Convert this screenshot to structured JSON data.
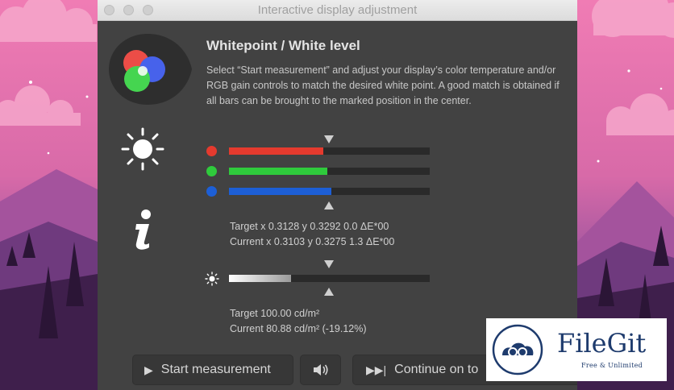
{
  "window": {
    "title": "Interactive display adjustment"
  },
  "section": {
    "heading": "Whitepoint / White level",
    "description": "Select “Start measurement” and adjust your display’s color temperature and/or RGB gain controls to match the desired white point. A good match is obtained if all bars can be brought to the marked position in the center."
  },
  "rgb_bars": [
    {
      "channel": "red",
      "color": "#e53a2e",
      "fill": 0.47
    },
    {
      "channel": "green",
      "color": "#2fcb3c",
      "fill": 0.49
    },
    {
      "channel": "blue",
      "color": "#1d5fd6",
      "fill": 0.51
    }
  ],
  "whitepoint": {
    "target": "Target x 0.3128 y 0.3292 0.0 ΔE*00",
    "current": "Current x 0.3103 y 0.3275 1.3 ΔE*00"
  },
  "luminance": {
    "fill": 0.31,
    "target": "Target 100.00 cd/m²",
    "current": "Current 80.88 cd/m² (-19.12%)"
  },
  "buttons": {
    "start": "Start measurement",
    "continue": "Continue on to"
  },
  "icons": {
    "rgb": "rgb-circles-icon",
    "brightness": "sun-icon",
    "info": "info-icon",
    "play": "play-icon",
    "sound": "speaker-icon",
    "skip": "skip-forward-icon"
  },
  "watermark": {
    "name": "FileGit",
    "tagline": "Free & Unlimited"
  }
}
